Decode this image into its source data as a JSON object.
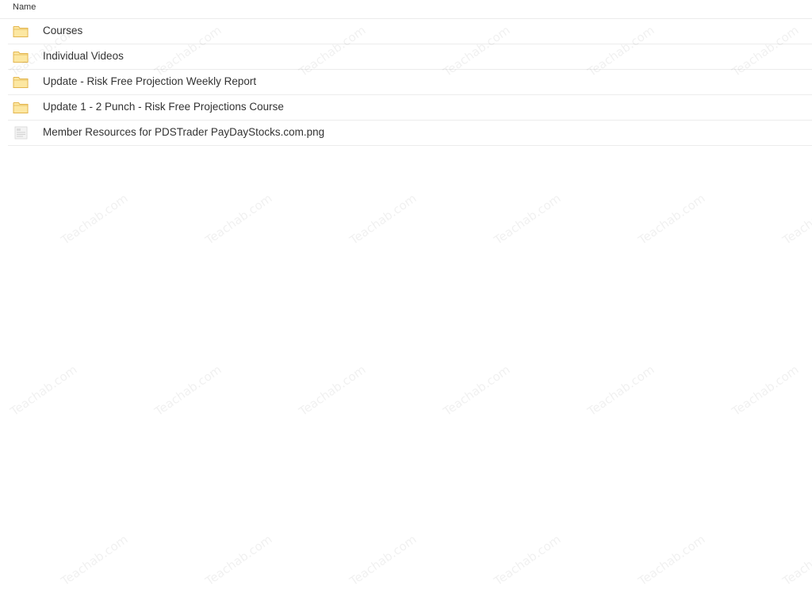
{
  "header": {
    "column_name": "Name"
  },
  "files": [
    {
      "name": "Courses",
      "type": "folder"
    },
    {
      "name": "Individual Videos",
      "type": "folder"
    },
    {
      "name": "Update - Risk Free Projection Weekly Report",
      "type": "folder"
    },
    {
      "name": "Update 1 - 2 Punch - Risk Free Projections Course",
      "type": "folder"
    },
    {
      "name": "Member Resources for PDSTrader PayDayStocks.com.png",
      "type": "image"
    }
  ],
  "icons": {
    "folder": "folder-icon",
    "image": "image-file-icon"
  },
  "colors": {
    "folder_fill": "#fce7a2",
    "folder_stroke": "#e3b54d",
    "row_border": "#ececec"
  },
  "watermark": {
    "text": "Teachab.com"
  }
}
